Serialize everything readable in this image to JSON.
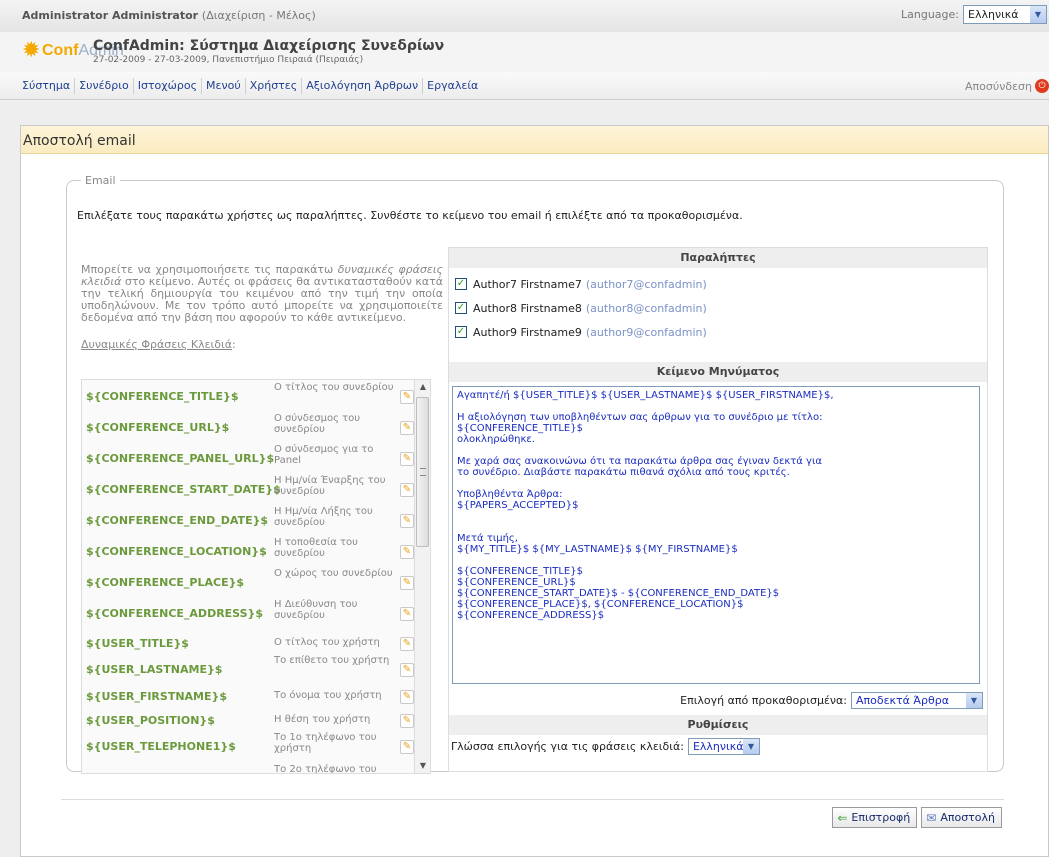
{
  "topbar": {
    "user_name": "Administrator Administrator",
    "user_role": "(Διαχείριση - Μέλος)",
    "language_label": "Language:",
    "language_value": "Ελληνικά"
  },
  "header": {
    "logo_conf": "Conf",
    "logo_admin": "Admin",
    "title": "ConfAdmin: Σύστημα Διαχείρισης Συνεδρίων",
    "subtitle": "27-02-2009 - 27-03-2009, Πανεπιστήμιο Πειραιά (Πειραιάς)"
  },
  "nav": {
    "items": [
      "Σύστημα",
      "Συνέδριο",
      "Ιστοχώρος",
      "Μενού",
      "Χρήστες",
      "Αξιολόγηση Άρθρων",
      "Εργαλεία"
    ],
    "logout": "Αποσύνδεση"
  },
  "panel": {
    "title": "Αποστολή email",
    "legend": "Email",
    "intro": "Επιλέξατε τους παρακάτω χρήστες ως παραλήπτες. Συνθέστε το κείμενο του email ή επιλέξτε από τα προκαθορισμένα."
  },
  "help": {
    "text_a": "Μπορείτε να χρησιμοποιήσετε τις παρακάτω ",
    "text_em": "δυναμικές φράσεις κλειδιά",
    "text_b": " στο κείμενο. Αυτές οι φράσεις θα αντικατασταθούν κατά την τελική δημιουργία του κειμένου από την τιμή την οποία υποδηλώνουν. Με τον τρόπο αυτό μπορείτε να χρησιμοποιείτε δεδομένα από την βάση που αφορούν το κάθε αντικείμενο.",
    "dynamic_title": "Δυναμικές Φράσεις Κλειδιά",
    "dynamic_colon": ":"
  },
  "keywords": [
    {
      "code": "${CONFERENCE_TITLE}$",
      "desc": "Ο τίτλος του συνεδρίου"
    },
    {
      "code": "${CONFERENCE_URL}$",
      "desc": "Ο σύνδεσμος του συνεδρίου"
    },
    {
      "code": "${CONFERENCE_PANEL_URL}$",
      "desc": "Ο σύνδεσμος για το Panel"
    },
    {
      "code": "${CONFERENCE_START_DATE}$",
      "desc": "Η Ημ/νία Έναρξης του συνεδρίου"
    },
    {
      "code": "${CONFERENCE_END_DATE}$",
      "desc": "Η Ημ/νία Λήξης του συνεδρίου"
    },
    {
      "code": "${CONFERENCE_LOCATION}$",
      "desc": "Η τοποθεσία του συνεδρίου"
    },
    {
      "code": "${CONFERENCE_PLACE}$",
      "desc": "Ο χώρος του συνεδρίου"
    },
    {
      "code": "${CONFERENCE_ADDRESS}$",
      "desc": "Η Διεύθυνση του συνεδρίου"
    },
    {
      "code": "${USER_TITLE}$",
      "desc": "Ο τίτλος του χρήστη"
    },
    {
      "code": "${USER_LASTNAME}$",
      "desc": "Το επίθετο του χρήστη"
    },
    {
      "code": "${USER_FIRSTNAME}$",
      "desc": "Το όνομα του χρήστη"
    },
    {
      "code": "${USER_POSITION}$",
      "desc": "Η θέση του χρήστη"
    },
    {
      "code": "${USER_TELEPHONE1}$",
      "desc": "Το 1ο τηλέφωνο του χρήστη"
    },
    {
      "code": "",
      "desc": "Το 2ο τηλέφωνο του"
    }
  ],
  "recipients": {
    "title": "Παραλήπτες",
    "items": [
      {
        "name": "Author7 Firstname7",
        "email": "(author7@confadmin)"
      },
      {
        "name": "Author8 Firstname8",
        "email": "(author8@confadmin)"
      },
      {
        "name": "Author9 Firstname9",
        "email": "(author9@confadmin)"
      }
    ]
  },
  "message": {
    "title": "Κείμενο Μηνύματος",
    "body": "Αγαπητέ/ή ${USER_TITLE}$ ${USER_LASTNAME}$ ${USER_FIRSTNAME}$,\n\nΗ αξιολόγηση των υποβληθέντων σας άρθρων για το συνέδριο με τίτλο:\n${CONFERENCE_TITLE}$\nολοκληρώθηκε.\n\nΜε χαρά σας ανακοινώνω ότι τα παρακάτω άρθρα σας έγιναν δεκτά για\nτο συνέδριο. Διαβάστε παρακάτω πιθανά σχόλια από τους κριτές.\n\nΥποβληθέντα Άρθρα:\n${PAPERS_ACCEPTED}$\n\n\nΜετά τιμής,\n${MY_TITLE}$ ${MY_LASTNAME}$ ${MY_FIRSTNAME}$\n\n${CONFERENCE_TITLE}$\n${CONFERENCE_URL}$\n${CONFERENCE_START_DATE}$ - ${CONFERENCE_END_DATE}$\n${CONFERENCE_PLACE}$, ${CONFERENCE_LOCATION}$\n${CONFERENCE_ADDRESS}$",
    "predefined_label": "Επιλογή από προκαθορισμένα:",
    "predefined_value": "Αποδεκτά Άρθρα"
  },
  "settings": {
    "title": "Ρυθμίσεις",
    "lang_label": "Γλώσσα επιλογής για τις φράσεις κλειδιά:",
    "lang_value": "Ελληνικά"
  },
  "buttons": {
    "back": "Επιστροφή",
    "send": "Αποστολή"
  }
}
